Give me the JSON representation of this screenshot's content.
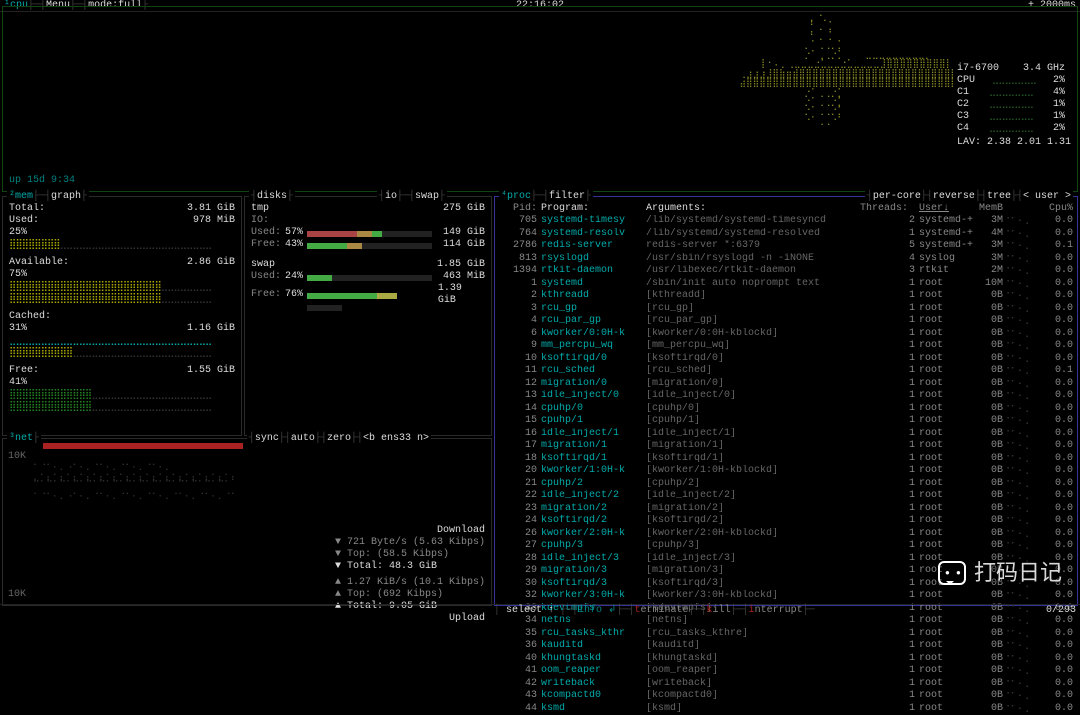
{
  "topbar": {
    "left_items": [
      "¹cpu",
      " ├─┤",
      "Menu",
      "├─┤",
      "mode:full",
      "├"
    ],
    "time": "22:16:02",
    "refresh": "+ 2000ms"
  },
  "cpu": {
    "uptime": "up 15d 9:34",
    "model": "i7-6700",
    "freq": "3.4 GHz",
    "rows": [
      {
        "label": "CPU",
        "pct": "2%"
      },
      {
        "label": "C1",
        "pct": "4%"
      },
      {
        "label": "C2",
        "pct": "1%"
      },
      {
        "label": "C3",
        "pct": "1%"
      },
      {
        "label": "C4",
        "pct": "2%"
      }
    ],
    "lav": "LAV: 2.38 2.01 1.31"
  },
  "mem": {
    "title_a": "²mem",
    "title_b": "graph",
    "rows": [
      {
        "l": "Total:",
        "r": "3.81 GiB"
      },
      {
        "l": "Used:",
        "r": "978 MiB"
      },
      {
        "l": "25%",
        "r": ""
      },
      {
        "l": "",
        "r": ""
      },
      {
        "l": "Available:",
        "r": "2.86 GiB"
      },
      {
        "l": "75%",
        "r": ""
      },
      {
        "l": "",
        "r": ""
      },
      {
        "l": "Cached:",
        "r": ""
      },
      {
        "l": "31%",
        "r": "1.16 GiB"
      },
      {
        "l": "",
        "r": ""
      },
      {
        "l": "Free:",
        "r": "1.55 GiB"
      },
      {
        "l": "41%",
        "r": ""
      }
    ]
  },
  "disks": {
    "title_a": "disks",
    "title_b": "io",
    "title_c": "swap",
    "tmp_label": "tmp",
    "tmp_val": "275 GiB",
    "io_label": "IO:",
    "used": {
      "label": "Used:",
      "pct": "57%",
      "val": "149 GiB"
    },
    "free": {
      "label": "Free:",
      "pct": "43%",
      "val": "114 GiB"
    },
    "swap_label": "swap",
    "swap_val": "1.85 GiB",
    "swap_used": {
      "label": "Used:",
      "pct": "24%",
      "val": "463 MiB"
    },
    "swap_free": {
      "label": "Free:",
      "pct": "76%",
      "val": "1.39 GiB"
    }
  },
  "net": {
    "title_a": "³net",
    "header_items": [
      "sync",
      "auto",
      "zero",
      "<b ens33 n>"
    ],
    "ytop": "10K",
    "ybot": "10K",
    "download": {
      "title": "Download",
      "lines": [
        "▼ 721 Byte/s (5.63 Kibps)",
        "▼ Top:       (58.5 Kibps)",
        "▼ Total:       48.3 GiB"
      ]
    },
    "upload": {
      "lines": [
        "▲ 1.27 KiB/s (10.1 Kibps)",
        "▲ Top:       (692 Kibps)",
        "▲ Total:       9.05 GiB"
      ],
      "title": "Upload"
    }
  },
  "proc": {
    "title_a": "⁴proc",
    "title_b": "filter",
    "right_tags": [
      "per-core",
      "reverse",
      "tree",
      "< user >"
    ],
    "header": {
      "pid": "Pid:",
      "prog": "Program:",
      "args": "Arguments:",
      "th": "Threads:",
      "user": "User↓",
      "mem": "MemB",
      "cpu": "Cpu%"
    },
    "rows": [
      {
        "pid": "705",
        "prog": "systemd-timesy",
        "args": "/lib/systemd/systemd-timesyncd",
        "th": "2",
        "user": "systemd-+",
        "mem": "3M",
        "cpu": "0.0"
      },
      {
        "pid": "764",
        "prog": "systemd-resolv",
        "args": "/lib/systemd/systemd-resolved",
        "th": "1",
        "user": "systemd-+",
        "mem": "4M",
        "cpu": "0.0"
      },
      {
        "pid": "2786",
        "prog": "redis-server",
        "args": "redis-server *:6379",
        "th": "5",
        "user": "systemd-+",
        "mem": "3M",
        "cpu": "0.1"
      },
      {
        "pid": "813",
        "prog": "rsyslogd",
        "args": "/usr/sbin/rsyslogd -n -iNONE",
        "th": "4",
        "user": "syslog",
        "mem": "3M",
        "cpu": "0.0"
      },
      {
        "pid": "1394",
        "prog": "rtkit-daemon",
        "args": "/usr/libexec/rtkit-daemon",
        "th": "3",
        "user": "rtkit",
        "mem": "2M",
        "cpu": "0.0"
      },
      {
        "pid": "1",
        "prog": "systemd",
        "args": "/sbin/init auto noprompt text",
        "th": "1",
        "user": "root",
        "mem": "10M",
        "cpu": "0.0"
      },
      {
        "pid": "2",
        "prog": "kthreadd",
        "args": "[kthreadd]",
        "th": "1",
        "user": "root",
        "mem": "0B",
        "cpu": "0.0"
      },
      {
        "pid": "3",
        "prog": "rcu_gp",
        "args": "[rcu_gp]",
        "th": "1",
        "user": "root",
        "mem": "0B",
        "cpu": "0.0"
      },
      {
        "pid": "4",
        "prog": "rcu_par_gp",
        "args": "[rcu_par_gp]",
        "th": "1",
        "user": "root",
        "mem": "0B",
        "cpu": "0.0"
      },
      {
        "pid": "6",
        "prog": "kworker/0:0H-k",
        "args": "[kworker/0:0H-kblockd]",
        "th": "1",
        "user": "root",
        "mem": "0B",
        "cpu": "0.0"
      },
      {
        "pid": "9",
        "prog": "mm_percpu_wq",
        "args": "[mm_percpu_wq]",
        "th": "1",
        "user": "root",
        "mem": "0B",
        "cpu": "0.0"
      },
      {
        "pid": "10",
        "prog": "ksoftirqd/0",
        "args": "[ksoftirqd/0]",
        "th": "1",
        "user": "root",
        "mem": "0B",
        "cpu": "0.0"
      },
      {
        "pid": "11",
        "prog": "rcu_sched",
        "args": "[rcu_sched]",
        "th": "1",
        "user": "root",
        "mem": "0B",
        "cpu": "0.1"
      },
      {
        "pid": "12",
        "prog": "migration/0",
        "args": "[migration/0]",
        "th": "1",
        "user": "root",
        "mem": "0B",
        "cpu": "0.0"
      },
      {
        "pid": "13",
        "prog": "idle_inject/0",
        "args": "[idle_inject/0]",
        "th": "1",
        "user": "root",
        "mem": "0B",
        "cpu": "0.0"
      },
      {
        "pid": "14",
        "prog": "cpuhp/0",
        "args": "[cpuhp/0]",
        "th": "1",
        "user": "root",
        "mem": "0B",
        "cpu": "0.0"
      },
      {
        "pid": "15",
        "prog": "cpuhp/1",
        "args": "[cpuhp/1]",
        "th": "1",
        "user": "root",
        "mem": "0B",
        "cpu": "0.0"
      },
      {
        "pid": "16",
        "prog": "idle_inject/1",
        "args": "[idle_inject/1]",
        "th": "1",
        "user": "root",
        "mem": "0B",
        "cpu": "0.0"
      },
      {
        "pid": "17",
        "prog": "migration/1",
        "args": "[migration/1]",
        "th": "1",
        "user": "root",
        "mem": "0B",
        "cpu": "0.0"
      },
      {
        "pid": "18",
        "prog": "ksoftirqd/1",
        "args": "[ksoftirqd/1]",
        "th": "1",
        "user": "root",
        "mem": "0B",
        "cpu": "0.0"
      },
      {
        "pid": "20",
        "prog": "kworker/1:0H-k",
        "args": "[kworker/1:0H-kblockd]",
        "th": "1",
        "user": "root",
        "mem": "0B",
        "cpu": "0.0"
      },
      {
        "pid": "21",
        "prog": "cpuhp/2",
        "args": "[cpuhp/2]",
        "th": "1",
        "user": "root",
        "mem": "0B",
        "cpu": "0.0"
      },
      {
        "pid": "22",
        "prog": "idle_inject/2",
        "args": "[idle_inject/2]",
        "th": "1",
        "user": "root",
        "mem": "0B",
        "cpu": "0.0"
      },
      {
        "pid": "23",
        "prog": "migration/2",
        "args": "[migration/2]",
        "th": "1",
        "user": "root",
        "mem": "0B",
        "cpu": "0.0"
      },
      {
        "pid": "24",
        "prog": "ksoftirqd/2",
        "args": "[ksoftirqd/2]",
        "th": "1",
        "user": "root",
        "mem": "0B",
        "cpu": "0.0"
      },
      {
        "pid": "26",
        "prog": "kworker/2:0H-k",
        "args": "[kworker/2:0H-kblockd]",
        "th": "1",
        "user": "root",
        "mem": "0B",
        "cpu": "0.0"
      },
      {
        "pid": "27",
        "prog": "cpuhp/3",
        "args": "[cpuhp/3]",
        "th": "1",
        "user": "root",
        "mem": "0B",
        "cpu": "0.0"
      },
      {
        "pid": "28",
        "prog": "idle_inject/3",
        "args": "[idle_inject/3]",
        "th": "1",
        "user": "root",
        "mem": "0B",
        "cpu": "0.0"
      },
      {
        "pid": "29",
        "prog": "migration/3",
        "args": "[migration/3]",
        "th": "1",
        "user": "root",
        "mem": "0B",
        "cpu": "0.0"
      },
      {
        "pid": "30",
        "prog": "ksoftirqd/3",
        "args": "[ksoftirqd/3]",
        "th": "1",
        "user": "root",
        "mem": "0B",
        "cpu": "0.0"
      },
      {
        "pid": "32",
        "prog": "kworker/3:0H-k",
        "args": "[kworker/3:0H-kblockd]",
        "th": "1",
        "user": "root",
        "mem": "0B",
        "cpu": "0.0"
      },
      {
        "pid": "33",
        "prog": "kdevtmpfs",
        "args": "[kdevtmpfs]",
        "th": "1",
        "user": "root",
        "mem": "0B",
        "cpu": "0.0"
      },
      {
        "pid": "34",
        "prog": "netns",
        "args": "[netns]",
        "th": "1",
        "user": "root",
        "mem": "0B",
        "cpu": "0.0"
      },
      {
        "pid": "35",
        "prog": "rcu_tasks_kthr",
        "args": "[rcu_tasks_kthre]",
        "th": "1",
        "user": "root",
        "mem": "0B",
        "cpu": "0.0"
      },
      {
        "pid": "36",
        "prog": "kauditd",
        "args": "[kauditd]",
        "th": "1",
        "user": "root",
        "mem": "0B",
        "cpu": "0.0"
      },
      {
        "pid": "40",
        "prog": "khungtaskd",
        "args": "[khungtaskd]",
        "th": "1",
        "user": "root",
        "mem": "0B",
        "cpu": "0.0"
      },
      {
        "pid": "41",
        "prog": "oom_reaper",
        "args": "[oom_reaper]",
        "th": "1",
        "user": "root",
        "mem": "0B",
        "cpu": "0.0"
      },
      {
        "pid": "42",
        "prog": "writeback",
        "args": "[writeback]",
        "th": "1",
        "user": "root",
        "mem": "0B",
        "cpu": "0.0"
      },
      {
        "pid": "43",
        "prog": "kcompactd0",
        "args": "[kcompactd0]",
        "th": "1",
        "user": "root",
        "mem": "0B",
        "cpu": "0.0"
      },
      {
        "pid": "44",
        "prog": "ksmd",
        "args": "[ksmd]",
        "th": "1",
        "user": "root",
        "mem": "0B",
        "cpu": "0.0"
      }
    ]
  },
  "bottombar": {
    "center": "│ select ↑ ├─┤info ↲├─┤terminate├─┤kill├─┤interrupt├─",
    "right": "0/293"
  },
  "watermark": "打码日记"
}
